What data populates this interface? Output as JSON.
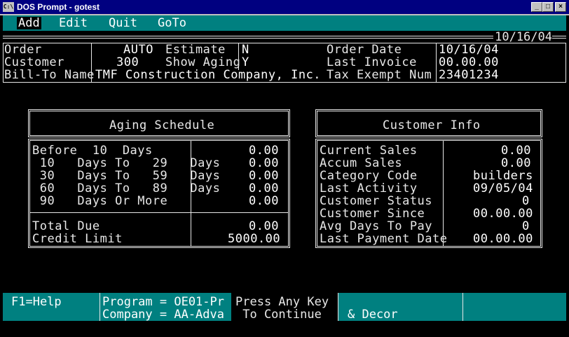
{
  "window": {
    "title": "DOS Prompt - gotest",
    "icon": "C:\\",
    "controls": [
      "minimize-icon",
      "maximize-icon",
      "close-icon"
    ]
  },
  "menu": {
    "items": [
      "Add",
      "Edit",
      "Quit",
      "GoTo"
    ],
    "date": "10/16/04"
  },
  "header": {
    "order_label": "Order",
    "order_value": "AUTO",
    "customer_label": "Customer",
    "customer_value": "300",
    "billto_label": "Bill-To Name",
    "billto_value": "TMF Construction Company, Inc.",
    "estimate_label": "Estimate",
    "estimate_value": "N",
    "show_aging_label": "Show Aging",
    "show_aging_value": "Y",
    "order_date_label": "Order Date",
    "order_date_value": "10/16/04",
    "last_invoice_label": "Last Invoice",
    "last_invoice_value": "00.00.00",
    "tax_exempt_label": "Tax Exempt Num",
    "tax_exempt_value": "23401234"
  },
  "aging": {
    "title": "Aging Schedule",
    "rows": [
      {
        "label": "Before  10  Days",
        "value": "0.00"
      },
      {
        "label": " 10   Days To   29   Days",
        "value": "0.00"
      },
      {
        "label": " 30   Days To   59   Days",
        "value": "0.00"
      },
      {
        "label": " 60   Days To   89   Days",
        "value": "0.00"
      },
      {
        "label": " 90   Days Or More",
        "value": "0.00"
      }
    ],
    "total_due_label": "Total Due",
    "total_due_value": "0.00",
    "credit_limit_label": "Credit Limit",
    "credit_limit_value": "5000.00"
  },
  "customer_info": {
    "title": "Customer Info",
    "rows": [
      {
        "label": "Current Sales",
        "value": "0.00"
      },
      {
        "label": "Accum Sales",
        "value": "0.00"
      },
      {
        "label": "Category Code",
        "value": "builders"
      },
      {
        "label": "Last Activity",
        "value": "09/05/04"
      },
      {
        "label": "Customer Status",
        "value": "0"
      },
      {
        "label": "Customer Since",
        "value": "00.00.00"
      },
      {
        "label": "Avg Days To Pay",
        "value": "0"
      },
      {
        "label": "Last Payment Date",
        "value": "00.00.00"
      }
    ]
  },
  "status": {
    "help": "F1=Help",
    "program": "Program = OE01-Pr",
    "company": "Company = AA-Adva",
    "press1": "Press Any Key",
    "press2": " To Continue",
    "decor": "& Decor"
  }
}
